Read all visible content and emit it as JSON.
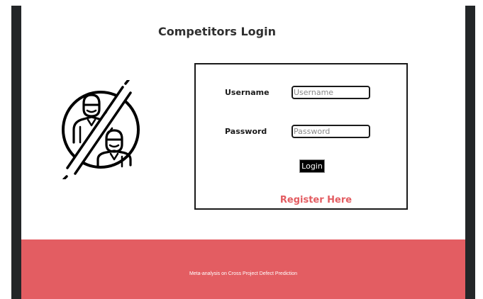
{
  "page": {
    "title": "Competitors Login"
  },
  "login_form": {
    "username_label": "Username",
    "username_placeholder": "Username",
    "username_value": "",
    "password_label": "Password",
    "password_placeholder": "Password",
    "password_value": "",
    "login_button": "Login",
    "register_link": "Register Here"
  },
  "footer": {
    "text": "Meta-analysis on Cross Project Defect Prediction"
  },
  "icons": {
    "illustration": "no-competitors-icon"
  },
  "colors": {
    "accent": "#e35d62",
    "frame": "#232628",
    "text": "#2f2f2f"
  }
}
